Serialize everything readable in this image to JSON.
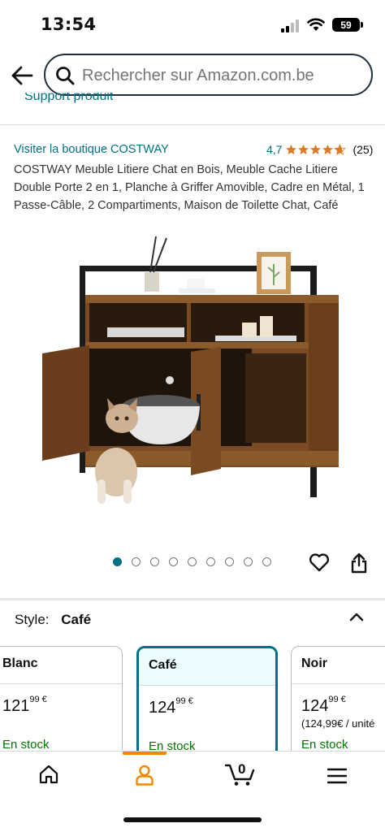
{
  "status_bar": {
    "time": "13:54",
    "battery": "59"
  },
  "search": {
    "placeholder": "Rechercher sur Amazon.com.be"
  },
  "support_link": "Support produit",
  "product": {
    "brand_link": "Visiter la boutique COSTWAY",
    "rating_value": "4,7",
    "rating_stars": 4.7,
    "rating_count": "(25)",
    "title": "COSTWAY Meuble Litiere Chat en Bois, Meuble Cache Litiere Double Porte 2 en 1, Planche à Griffer Amovible, Cadre en Métal, 1 Passe-Câble, 2 Compartiments, Maison de Toilette Chat, Café",
    "image_count": 8,
    "active_image": 0
  },
  "style_selector": {
    "label": "Style:",
    "value": "Café"
  },
  "swatches": [
    {
      "name": "Blanc",
      "price_whole": "121",
      "price_fraction": "99 €",
      "unit": "",
      "stock": "En stock"
    },
    {
      "name": "Café",
      "price_whole": "124",
      "price_fraction": "99 €",
      "unit": "",
      "stock": "En stock",
      "selected": true
    },
    {
      "name": "Noir",
      "price_whole": "124",
      "price_fraction": "99 €",
      "unit": "(124,99€ / unité",
      "stock": "En stock"
    }
  ],
  "bottom_nav": {
    "cart_count": "0"
  },
  "colors": {
    "link": "#007185",
    "star": "#de7921",
    "stock": "#007600",
    "nav_accent": "#f08804"
  }
}
